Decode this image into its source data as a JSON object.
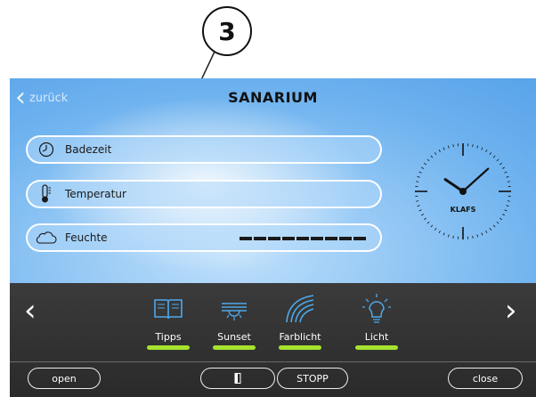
{
  "callout": {
    "number": "3"
  },
  "header": {
    "back_label": "zurück",
    "title": "SANARIUM"
  },
  "controls": [
    {
      "label": "Badezeit",
      "icon": "clock-icon"
    },
    {
      "label": "Temperatur",
      "icon": "thermometer-icon"
    },
    {
      "label": "Feuchte",
      "icon": "cloud-icon",
      "level_segments": 9
    }
  ],
  "clock": {
    "brand": "KLAFS",
    "time": "10:08"
  },
  "toolbar": {
    "items": [
      {
        "label": "Tipps",
        "icon": "book-icon"
      },
      {
        "label": "Sunset",
        "icon": "sunset-icon"
      },
      {
        "label": "Farblicht",
        "icon": "rainbow-icon"
      },
      {
        "label": "Licht",
        "icon": "lightbulb-icon"
      }
    ],
    "open_label": "open",
    "stop_label": "STOPP",
    "close_label": "close",
    "underline_color": "#a6e22e",
    "icon_color": "#4fa8ea"
  }
}
